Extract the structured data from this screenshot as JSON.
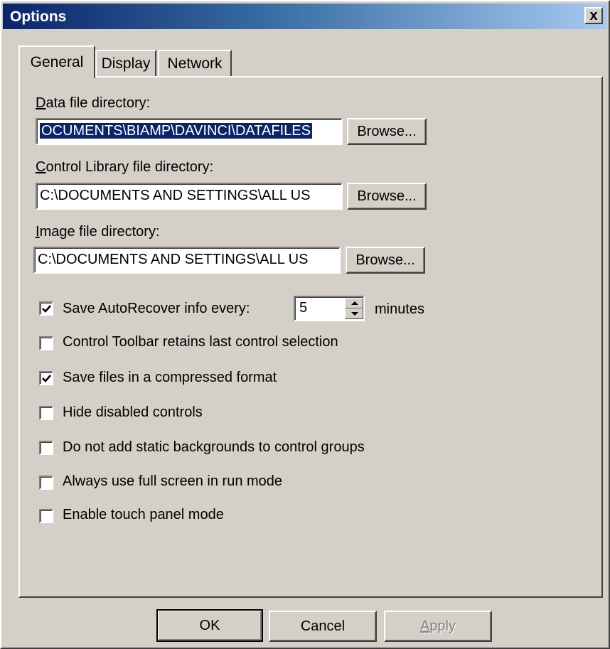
{
  "window": {
    "title": "Options",
    "close_glyph": "x"
  },
  "tabs": [
    {
      "label": "General",
      "active": true
    },
    {
      "label": "Display",
      "active": false
    },
    {
      "label": "Network",
      "active": false
    }
  ],
  "general": {
    "data_dir": {
      "label_first": "D",
      "label_rest": "ata file directory:",
      "value": "OCUMENTS\\BIAMP\\DAVINCI\\DATAFILES",
      "browse_label": "Browse..."
    },
    "control_lib_dir": {
      "label_first": "C",
      "label_rest": "ontrol Library file directory:",
      "value": "C:\\DOCUMENTS AND SETTINGS\\ALL US",
      "browse_label": "Browse..."
    },
    "image_dir": {
      "label_first": "I",
      "label_rest": "mage file directory:",
      "value": "C:\\DOCUMENTS AND SETTINGS\\ALL US",
      "browse_label": "Browse..."
    },
    "autorecover": {
      "label": "Save AutoRecover info every:",
      "checked": true,
      "value": "5",
      "unit": "minutes"
    },
    "options": [
      {
        "label": "Control Toolbar retains last control selection",
        "checked": false
      },
      {
        "label": "Save files in a compressed format",
        "checked": true
      },
      {
        "label": "Hide disabled controls",
        "checked": false
      },
      {
        "label": "Do not add static backgrounds to control groups",
        "checked": false
      },
      {
        "label": "Always use full screen in run mode",
        "checked": false
      },
      {
        "label": "Enable touch panel mode",
        "checked": false
      }
    ]
  },
  "footer": {
    "ok_label": "OK",
    "cancel_label": "Cancel",
    "apply_first": "A",
    "apply_rest": "pply"
  },
  "colors": {
    "face": "#d4d0c8",
    "title_start": "#0a246a",
    "title_end": "#a6caf0",
    "selection": "#0a246a"
  }
}
